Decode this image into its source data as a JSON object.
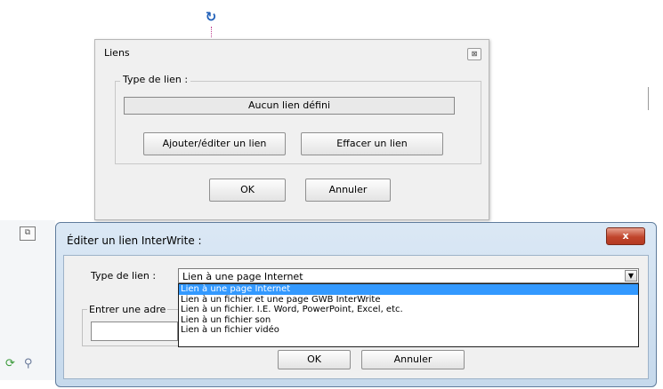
{
  "icons": {
    "rotate_handle": "rotate-icon",
    "side_icon": "copy-window-icon",
    "bottom_1": "refresh-icon",
    "bottom_2": "tool-icon"
  },
  "liens_dialog": {
    "title": "Liens",
    "close_label": "⊠",
    "group_label": "Type de lien :",
    "current_link": "Aucun lien défini",
    "add_edit_button": "Ajouter/éditer un lien",
    "clear_button": "Effacer un lien",
    "ok_button": "OK",
    "cancel_button": "Annuler"
  },
  "interwrite_dialog": {
    "title": "Éditer un lien InterWrite :",
    "close_label": "x",
    "type_label": "Type de lien :",
    "selected_value": "Lien à une page Internet",
    "options": [
      "Lien à une page Internet",
      "Lien à un fichier et une page GWB InterWrite",
      "Lien à un fichier. I.E. Word, PowerPoint, Excel, etc.",
      "Lien à un fichier son",
      "Lien à un fichier vidéo"
    ],
    "highlighted_option_index": 0,
    "address_label": "Entrer une adre",
    "address_value": "",
    "ok_button": "OK",
    "cancel_button": "Annuler"
  },
  "colors": {
    "selection": "#3399ff",
    "close_button": "#c0452c",
    "titlebar": "#c6d9ec"
  }
}
